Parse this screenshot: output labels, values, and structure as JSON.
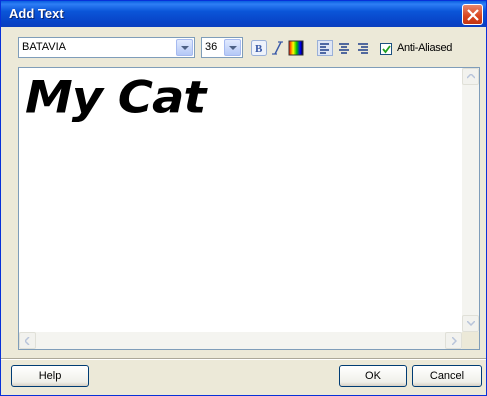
{
  "window": {
    "title": "Add Text"
  },
  "toolbar": {
    "font": "BATAVIA",
    "size": "36",
    "anti_aliased_label": "Anti-Aliased",
    "anti_aliased_checked": true
  },
  "editor": {
    "text": "My Cat"
  },
  "buttons": {
    "help": "Help",
    "ok": "OK",
    "cancel": "Cancel"
  }
}
